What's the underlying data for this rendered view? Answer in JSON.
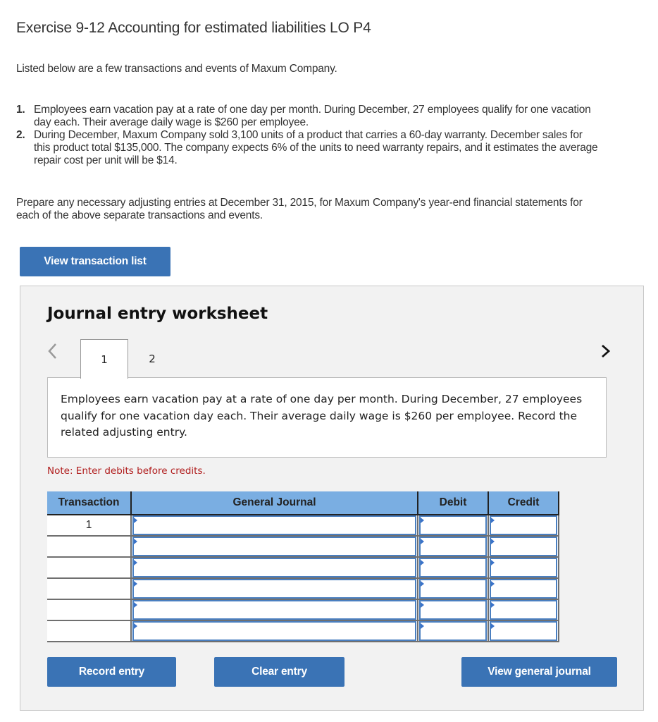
{
  "header": {
    "title": "Exercise 9-12 Accounting for estimated liabilities LO P4",
    "intro": "Listed below are a few transactions and events of Maxum Company."
  },
  "transactions": [
    {
      "number": "1.",
      "text": "Employees earn vacation pay at a rate of one day per month. During December, 27 employees qualify for one vacation day each. Their average daily wage is $260 per employee."
    },
    {
      "number": "2.",
      "text": "During December, Maxum Company sold 3,100 units of a product that carries a 60-day warranty. December sales for this product total $135,000. The company expects 6% of the units to need warranty repairs, and it estimates the average repair cost per unit will be $14."
    }
  ],
  "prompt": "Prepare any necessary adjusting entries at December 31, 2015, for Maxum Company's year-end financial statements for each of the above separate transactions and events.",
  "buttons": {
    "view_transaction_list": "View transaction list",
    "record_entry": "Record entry",
    "clear_entry": "Clear entry",
    "view_general_journal": "View general journal"
  },
  "worksheet": {
    "title": "Journal entry worksheet",
    "prev_icon": "chevron-left-icon",
    "next_icon": "chevron-right-icon",
    "tabs": [
      {
        "label": "1",
        "active": true
      },
      {
        "label": "2",
        "active": false
      }
    ],
    "description": "Employees earn vacation pay at a rate of one day per month. During December, 27 employees qualify for one vacation day each. Their average daily wage is $260 per employee. Record the related adjusting entry.",
    "note": "Note: Enter debits before credits."
  },
  "journal_table": {
    "columns": [
      "Transaction",
      "General Journal",
      "Debit",
      "Credit"
    ],
    "rows": [
      {
        "transaction": "1",
        "general_journal": "",
        "debit": "",
        "credit": ""
      },
      {
        "transaction": "",
        "general_journal": "",
        "debit": "",
        "credit": ""
      },
      {
        "transaction": "",
        "general_journal": "",
        "debit": "",
        "credit": ""
      },
      {
        "transaction": "",
        "general_journal": "",
        "debit": "",
        "credit": ""
      },
      {
        "transaction": "",
        "general_journal": "",
        "debit": "",
        "credit": ""
      },
      {
        "transaction": "",
        "general_journal": "",
        "debit": "",
        "credit": ""
      }
    ]
  },
  "colors": {
    "button_blue": "#3a73b5",
    "header_blue": "#7aaee2",
    "note_red": "#b01c1c"
  }
}
